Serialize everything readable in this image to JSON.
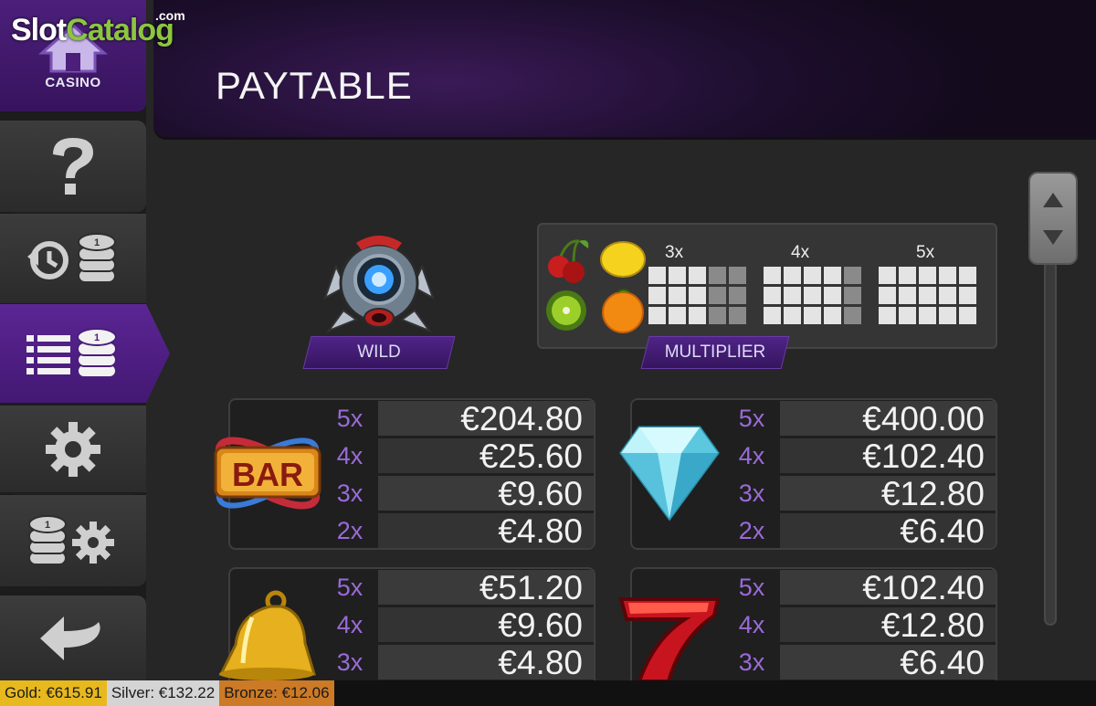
{
  "logo": {
    "part1": "Slot",
    "part2": "Catalog",
    "suffix": ".com"
  },
  "sidebar": {
    "home_label": "CASINO"
  },
  "header": {
    "title": "PAYTABLE"
  },
  "wild": {
    "label": "WILD"
  },
  "multiplier": {
    "label": "MULTIPLIER",
    "groups": [
      "3x",
      "4x",
      "5x"
    ]
  },
  "paytables": [
    {
      "symbol": "bar",
      "rows": [
        {
          "count": "5x",
          "amount": "€204.80"
        },
        {
          "count": "4x",
          "amount": "€25.60"
        },
        {
          "count": "3x",
          "amount": "€9.60"
        },
        {
          "count": "2x",
          "amount": "€4.80"
        }
      ]
    },
    {
      "symbol": "diamond",
      "rows": [
        {
          "count": "5x",
          "amount": "€400.00"
        },
        {
          "count": "4x",
          "amount": "€102.40"
        },
        {
          "count": "3x",
          "amount": "€12.80"
        },
        {
          "count": "2x",
          "amount": "€6.40"
        }
      ]
    },
    {
      "symbol": "bell",
      "rows": [
        {
          "count": "5x",
          "amount": "€51.20"
        },
        {
          "count": "4x",
          "amount": "€9.60"
        },
        {
          "count": "3x",
          "amount": "€4.80"
        }
      ]
    },
    {
      "symbol": "seven",
      "rows": [
        {
          "count": "5x",
          "amount": "€102.40"
        },
        {
          "count": "4x",
          "amount": "€12.80"
        },
        {
          "count": "3x",
          "amount": "€6.40"
        }
      ]
    }
  ],
  "jackpots": {
    "gold": "Gold: €615.91",
    "silver": "Silver: €132.22",
    "bronze": "Bronze: €12.06"
  },
  "colors": {
    "accent_purple": "#4f2487",
    "count_purple": "#9a6ad8",
    "gold": "#e8b91e",
    "silver": "#d4d4d4",
    "bronze": "#cc7a25"
  }
}
